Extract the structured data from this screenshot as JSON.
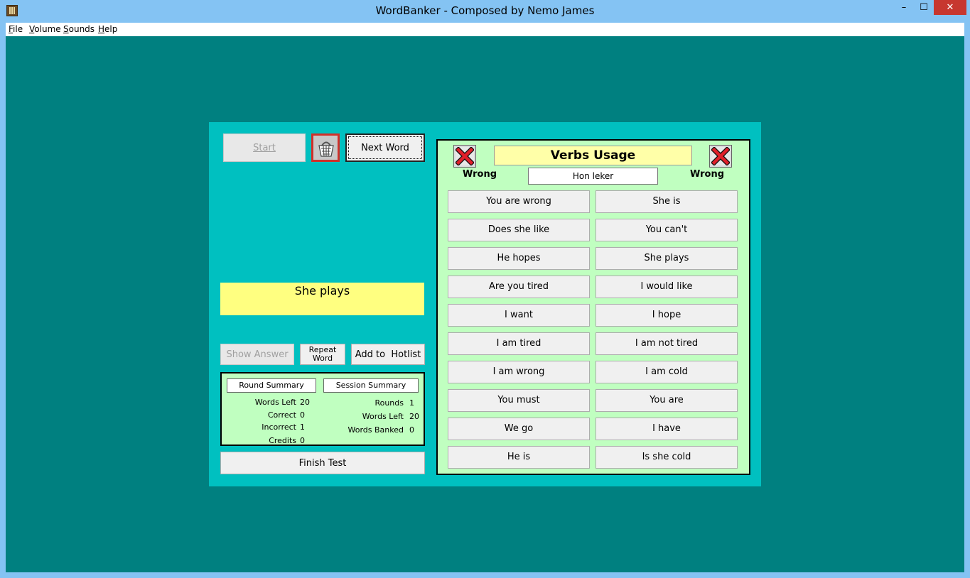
{
  "window": {
    "title": "WordBanker - Composed by Nemo James",
    "controls": {
      "minimize": "–",
      "maximize": "☐",
      "close": "✕"
    }
  },
  "menu": [
    "File",
    "Volume",
    "Sounds",
    "Help"
  ],
  "colors": {
    "client_bg": "#008080",
    "panel_bg": "#00c0c0",
    "answer_bg": "#ffff80",
    "quiz_bg": "#c0ffc0"
  },
  "controls": {
    "start": "Start",
    "basket_icon": "basket-icon",
    "next_word": "Next Word",
    "show_answer": "Show Answer",
    "repeat_word_line1": "Repeat",
    "repeat_word_line2": "Word",
    "add_to_hotlist": "Add to  Hotlist",
    "finish_test": "Finish Test"
  },
  "answer_display": "She plays",
  "summary": {
    "round_heading": "Round Summary",
    "session_heading": "Session Summary",
    "round": [
      {
        "label": "Words Left",
        "value": "20"
      },
      {
        "label": "Correct",
        "value": "0"
      },
      {
        "label": "Incorrect",
        "value": "1"
      },
      {
        "label": "Credits",
        "value": "0"
      }
    ],
    "session": [
      {
        "label": "Rounds",
        "value": "1"
      },
      {
        "label": "Words Left",
        "value": "20"
      },
      {
        "label": "Words Banked",
        "value": "0"
      }
    ]
  },
  "quiz": {
    "title": "Verbs Usage",
    "hint": "Hon leker",
    "left_status": "Wrong",
    "right_status": "Wrong",
    "choices_left": [
      "You are wrong",
      "Does she like",
      "He hopes",
      "Are you tired",
      "I want",
      "I am tired",
      "I am wrong",
      "You must",
      "We go",
      "He is"
    ],
    "choices_right": [
      "She is",
      "You can't",
      "She plays",
      "I would like",
      "I hope",
      "I am not tired",
      "I am cold",
      "You are",
      "I have",
      "Is she cold"
    ]
  }
}
